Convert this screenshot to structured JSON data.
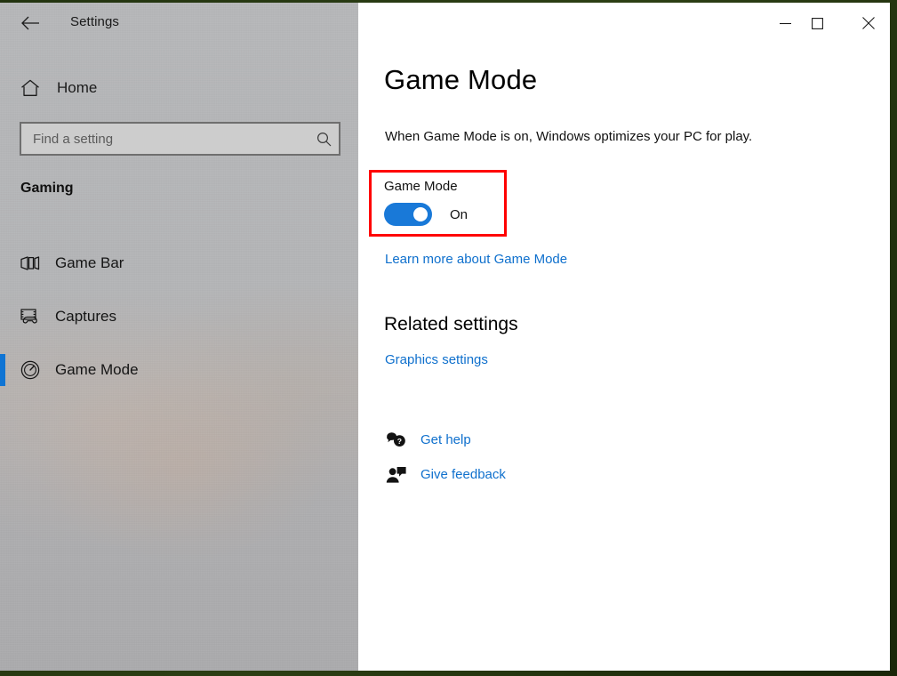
{
  "window": {
    "app_title": "Settings",
    "back_icon": "back-arrow-icon",
    "controls": {
      "minimize": "minimize-icon",
      "maximize": "maximize-icon",
      "close": "close-icon"
    }
  },
  "sidebar": {
    "home": {
      "label": "Home",
      "icon": "home-icon"
    },
    "search": {
      "placeholder": "Find a setting",
      "value": "",
      "icon": "search-icon"
    },
    "category": "Gaming",
    "items": [
      {
        "label": "Game Bar",
        "icon": "game-bar-icon",
        "selected": false
      },
      {
        "label": "Captures",
        "icon": "captures-icon",
        "selected": false
      },
      {
        "label": "Game Mode",
        "icon": "game-mode-gauge-icon",
        "selected": true
      }
    ]
  },
  "main": {
    "title": "Game Mode",
    "description": "When Game Mode is on, Windows optimizes your PC for play.",
    "toggle": {
      "label": "Game Mode",
      "state": "On",
      "checked": true
    },
    "learn_more_link": "Learn more about Game Mode",
    "related_heading": "Related settings",
    "related_links": [
      {
        "label": "Graphics settings"
      }
    ],
    "support": [
      {
        "label": "Get help",
        "icon": "get-help-icon"
      },
      {
        "label": "Give feedback",
        "icon": "give-feedback-icon"
      }
    ]
  },
  "colors": {
    "accent": "#0f70cd",
    "toggle_on": "#1979d8",
    "highlight": "#ff0000",
    "selection_indicator": "#0f74d4"
  }
}
